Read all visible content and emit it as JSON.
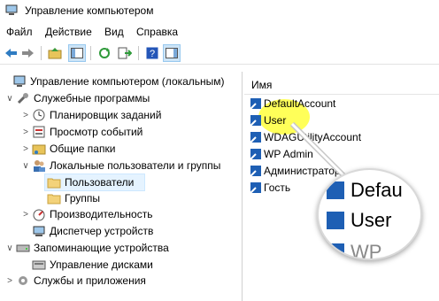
{
  "window": {
    "title": "Управление компьютером"
  },
  "menu": [
    "Файл",
    "Действие",
    "Вид",
    "Справка"
  ],
  "tree": [
    {
      "label": "Управление компьютером (локальным)",
      "indent": 0,
      "twisty": "",
      "icon": "computer-icon"
    },
    {
      "label": "Служебные программы",
      "indent": 1,
      "twisty": "∨",
      "icon": "tools-icon"
    },
    {
      "label": "Планировщик заданий",
      "indent": 2,
      "twisty": ">",
      "icon": "clock-icon"
    },
    {
      "label": "Просмотр событий",
      "indent": 2,
      "twisty": ">",
      "icon": "event-viewer-icon"
    },
    {
      "label": "Общие папки",
      "indent": 2,
      "twisty": ">",
      "icon": "shared-folder-icon"
    },
    {
      "label": "Локальные пользователи и группы",
      "indent": 2,
      "twisty": "∨",
      "icon": "users-icon"
    },
    {
      "label": "Пользователи",
      "indent": 3,
      "twisty": "",
      "icon": "folder-icon",
      "selected": true
    },
    {
      "label": "Группы",
      "indent": 3,
      "twisty": "",
      "icon": "folder-icon"
    },
    {
      "label": "Производительность",
      "indent": 2,
      "twisty": ">",
      "icon": "performance-icon"
    },
    {
      "label": "Диспетчер устройств",
      "indent": 2,
      "twisty": "",
      "icon": "device-manager-icon"
    },
    {
      "label": "Запоминающие устройства",
      "indent": 1,
      "twisty": "∨",
      "icon": "storage-icon"
    },
    {
      "label": "Управление дисками",
      "indent": 2,
      "twisty": "",
      "icon": "disk-icon"
    },
    {
      "label": "Службы и приложения",
      "indent": 1,
      "twisty": ">",
      "icon": "services-icon"
    }
  ],
  "list": {
    "header": "Имя",
    "users": [
      "DefaultAccount",
      "User",
      "WDAGUtilityAccount",
      "WP Admin",
      "Администратор",
      "Гость"
    ]
  },
  "magnifier": [
    "Defau",
    "User",
    "WP"
  ],
  "colors": {
    "selection": "#e5f3ff",
    "highlight": "#ffff00",
    "user_icon": "#1e5fb4"
  }
}
